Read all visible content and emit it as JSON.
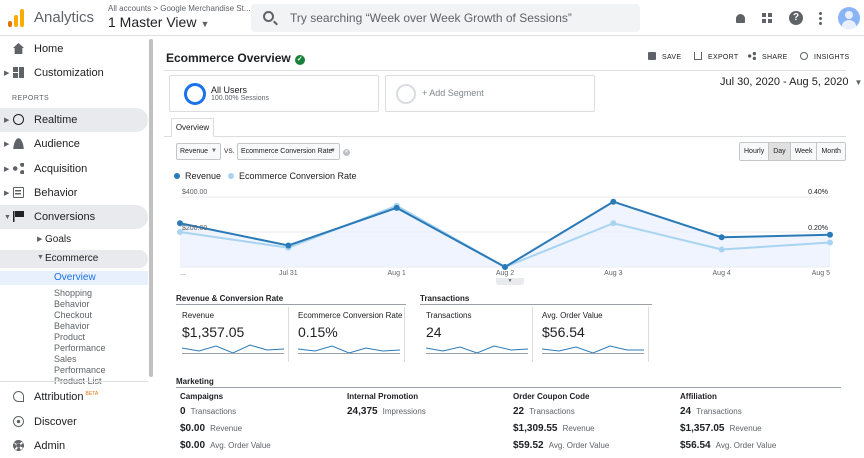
{
  "app": {
    "name": "Analytics",
    "account_path": "All accounts > Google Merchandise St...",
    "view": "1 Master View"
  },
  "search": {
    "placeholder": "Try searching “Week over Week Growth of Sessions”"
  },
  "sidebar": {
    "home": "Home",
    "customization": "Customization",
    "reports_label": "REPORTS",
    "realtime": "Realtime",
    "audience": "Audience",
    "acquisition": "Acquisition",
    "behavior": "Behavior",
    "conversions": "Conversions",
    "goals": "Goals",
    "ecommerce": "Ecommerce",
    "overview": "Overview",
    "leaves": [
      "Shopping",
      "Behavior",
      "Checkout",
      "Behavior",
      "Product",
      "Performance",
      "Sales",
      "Performance",
      "Product List"
    ],
    "attribution": "Attribution",
    "beta": "BETA",
    "discover": "Discover",
    "admin": "Admin"
  },
  "header": {
    "title": "Ecommerce Overview",
    "save": "SAVE",
    "export": "EXPORT",
    "share": "SHARE",
    "insights": "INSIGHTS"
  },
  "segments": {
    "primary_name": "All Users",
    "primary_sub": "100.00% Sessions",
    "add": "+ Add Segment"
  },
  "date_range": "Jul 30, 2020 - Aug 5, 2020",
  "tabs": {
    "overview": "Overview"
  },
  "controls": {
    "metric1": "Revenue",
    "vs": "VS.",
    "metric2": "Ecommerce Conversion Rate",
    "granularity": [
      "Hourly",
      "Day",
      "Week",
      "Month"
    ],
    "granularity_selected": "Day"
  },
  "colors": {
    "series1": "#2a7ab8",
    "series2": "#a8d4f0",
    "accent": "#1a73e8",
    "verified": "#188038"
  },
  "chart_data": {
    "type": "line",
    "x": [
      "...",
      "Jul 31",
      "Aug 1",
      "Aug 2",
      "Aug 3",
      "Aug 4",
      "Aug 5"
    ],
    "series": [
      {
        "name": "Revenue",
        "values": [
          250,
          123,
          338,
          0,
          373,
          170,
          184
        ],
        "axis": "left",
        "ticks": [
          "$400.00",
          "$200.00"
        ],
        "max": 400
      },
      {
        "name": "Ecommerce Conversion Rate",
        "values": [
          0.2,
          0.11,
          0.35,
          0,
          0.25,
          0.1,
          0.14
        ],
        "axis": "right",
        "ticks": [
          "0.40%",
          "0.20%"
        ],
        "max": 0.4
      }
    ]
  },
  "rev_conv": {
    "title": "Revenue & Conversion Rate",
    "revenue_label": "Revenue",
    "revenue_value": "$1,357.05",
    "conv_label": "Ecommerce Conversion Rate",
    "conv_value": "0.15%"
  },
  "transactions": {
    "title": "Transactions",
    "tx_label": "Transactions",
    "tx_value": "24",
    "aov_label": "Avg. Order Value",
    "aov_value": "$56.54"
  },
  "marketing": {
    "title": "Marketing",
    "campaigns": {
      "head": "Campaigns",
      "r1v": "0",
      "r1l": "Transactions",
      "r2v": "$0.00",
      "r2l": "Revenue",
      "r3v": "$0.00",
      "r3l": "Avg. Order Value"
    },
    "internal": {
      "head": "Internal Promotion",
      "r1v": "24,375",
      "r1l": "Impressions"
    },
    "coupon": {
      "head": "Order Coupon Code",
      "r1v": "22",
      "r1l": "Transactions",
      "r2v": "$1,309.55",
      "r2l": "Revenue",
      "r3v": "$59.52",
      "r3l": "Avg. Order Value"
    },
    "affiliation": {
      "head": "Affiliation",
      "r1v": "24",
      "r1l": "Transactions",
      "r2v": "$1,357.05",
      "r2l": "Revenue",
      "r3v": "$56.54",
      "r3l": "Avg. Order Value"
    }
  }
}
